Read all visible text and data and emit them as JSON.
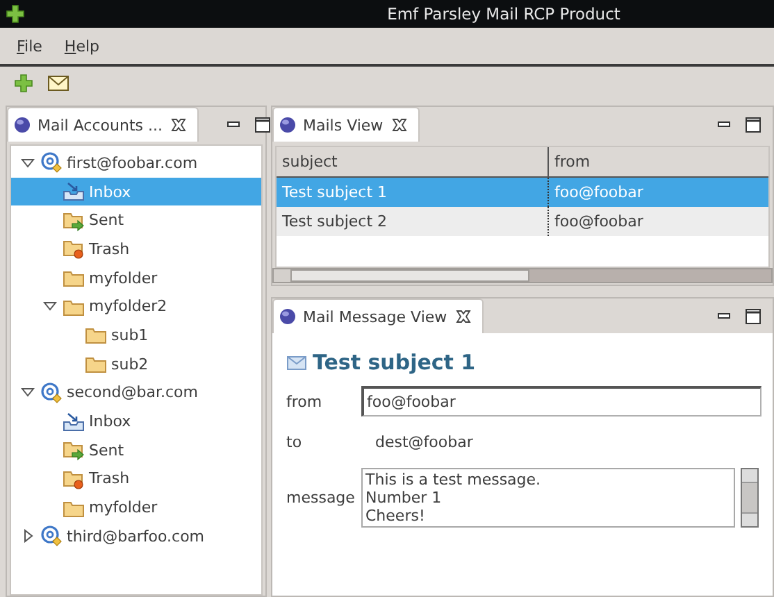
{
  "window": {
    "title": "Emf Parsley Mail RCP Product"
  },
  "menu": [
    {
      "label": "File"
    },
    {
      "label": "Help"
    }
  ],
  "accounts_view": {
    "tab": {
      "title": "Mail Accounts ...",
      "selected": true
    },
    "tree": [
      {
        "label": "first@foobar.com",
        "kind": "account",
        "expanded": true,
        "selected": false,
        "children": [
          {
            "label": "Inbox",
            "kind": "inbox",
            "selected": true
          },
          {
            "label": "Sent",
            "kind": "sent",
            "selected": false
          },
          {
            "label": "Trash",
            "kind": "trash",
            "selected": false
          },
          {
            "label": "myfolder",
            "kind": "folder",
            "selected": false
          },
          {
            "label": "myfolder2",
            "kind": "folder",
            "expanded": true,
            "selected": false,
            "children": [
              {
                "label": "sub1",
                "kind": "folder",
                "selected": false
              },
              {
                "label": "sub2",
                "kind": "folder",
                "selected": false
              }
            ]
          }
        ]
      },
      {
        "label": "second@bar.com",
        "kind": "account",
        "expanded": true,
        "selected": false,
        "children": [
          {
            "label": "Inbox",
            "kind": "inbox",
            "selected": false
          },
          {
            "label": "Sent",
            "kind": "sent",
            "selected": false
          },
          {
            "label": "Trash",
            "kind": "trash",
            "selected": false
          },
          {
            "label": "myfolder",
            "kind": "folder",
            "selected": false
          }
        ]
      },
      {
        "label": "third@barfoo.com",
        "kind": "account",
        "expanded": false,
        "selected": false
      }
    ]
  },
  "mails_view": {
    "tab": {
      "title": "Mails View",
      "selected": true
    },
    "table": {
      "columns": [
        "subject",
        "from"
      ],
      "rows": [
        {
          "cells": [
            "Test subject 1",
            "foo@foobar"
          ],
          "selected": true
        },
        {
          "cells": [
            "Test subject 2",
            "foo@foobar"
          ],
          "selected": false
        }
      ]
    }
  },
  "message_view": {
    "tab": {
      "title": "Mail Message View",
      "selected": true
    },
    "heading": "Test subject 1",
    "fields": [
      {
        "label": "from",
        "kind": "input",
        "value": "foo@foobar"
      },
      {
        "label": "to",
        "kind": "text",
        "value": "dest@foobar"
      },
      {
        "label": "message",
        "kind": "textarea",
        "lines": [
          "This is a test message.",
          "Number 1",
          "Cheers!"
        ]
      }
    ]
  }
}
